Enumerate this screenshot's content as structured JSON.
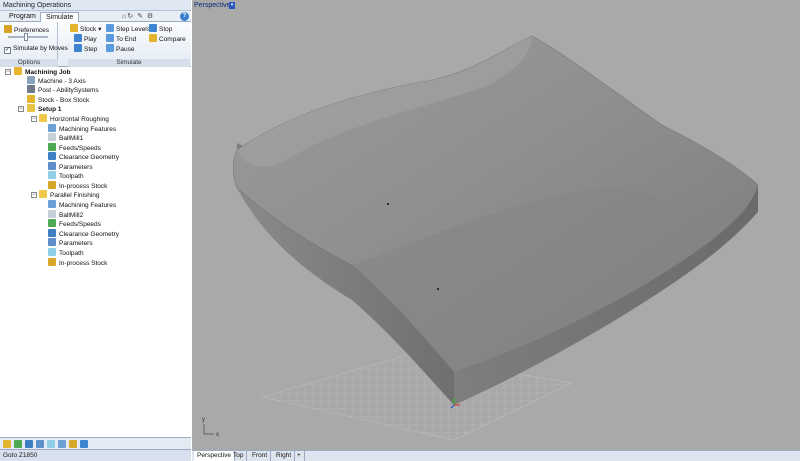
{
  "window": {
    "title": "Machining Operations"
  },
  "tabs": [
    {
      "label": "Program"
    },
    {
      "label": "Simulate"
    }
  ],
  "ribbon": {
    "options": {
      "preferences": "Preferences",
      "simulate_by_moves": "Simulate by Moves",
      "simulate_by_moves_checked": true,
      "group_label": "Options"
    },
    "simulate": {
      "stock": "Stock",
      "play": "Play",
      "step": "Step",
      "step_levels": "Step Levels",
      "to_end": "To End",
      "pause": "Pause",
      "stop": "Stop",
      "compare": "Compare",
      "group_label": "Simulate"
    }
  },
  "tree": [
    {
      "label": "Machining Job",
      "bold": true,
      "icon": "job-icon"
    },
    {
      "label": "Machine - 3 Axis",
      "icon": "machine-icon"
    },
    {
      "label": "Post - AbilitySystems",
      "icon": "post-icon"
    },
    {
      "label": "Stock - Box Stock",
      "icon": "stock-icon"
    },
    {
      "label": "Setup 1",
      "bold": true,
      "icon": "setup-icon"
    },
    {
      "label": "Horizontal Roughing",
      "icon": "folder-icon"
    },
    {
      "label": "Machining Features",
      "icon": "features-icon"
    },
    {
      "label": "BallMill1",
      "icon": "tool-icon"
    },
    {
      "label": "Feeds/Speeds",
      "icon": "feeds-icon"
    },
    {
      "label": "Clearance Geometry",
      "icon": "clearance-icon"
    },
    {
      "label": "Parameters",
      "icon": "parameters-icon"
    },
    {
      "label": "Toolpath",
      "icon": "toolpath-icon"
    },
    {
      "label": "In-process Stock",
      "icon": "in-process-stock-icon"
    },
    {
      "label": "Parallel Finishing",
      "icon": "folder-icon"
    },
    {
      "label": "Machining Features",
      "icon": "features-icon"
    },
    {
      "label": "BallMill2",
      "icon": "tool-icon"
    },
    {
      "label": "Feeds/Speeds",
      "icon": "feeds-icon"
    },
    {
      "label": "Clearance Geometry",
      "icon": "clearance-icon"
    },
    {
      "label": "Parameters",
      "icon": "parameters-icon"
    },
    {
      "label": "Toolpath",
      "icon": "toolpath-icon"
    },
    {
      "label": "In-process Stock",
      "icon": "in-process-stock-icon"
    }
  ],
  "status": {
    "text": "Goto Z1850"
  },
  "viewport": {
    "title": "Perspective",
    "tabs": [
      {
        "label": "Perspective"
      },
      {
        "label": "Top"
      },
      {
        "label": "Front"
      },
      {
        "label": "Right"
      },
      {
        "label": "+"
      }
    ],
    "axis_x": "x",
    "axis_y": "y"
  },
  "colors": {
    "viewport_bg": "#a9a9a9",
    "part_gray": "#8c8c8c",
    "panel_bg": "#f4f6f9"
  }
}
